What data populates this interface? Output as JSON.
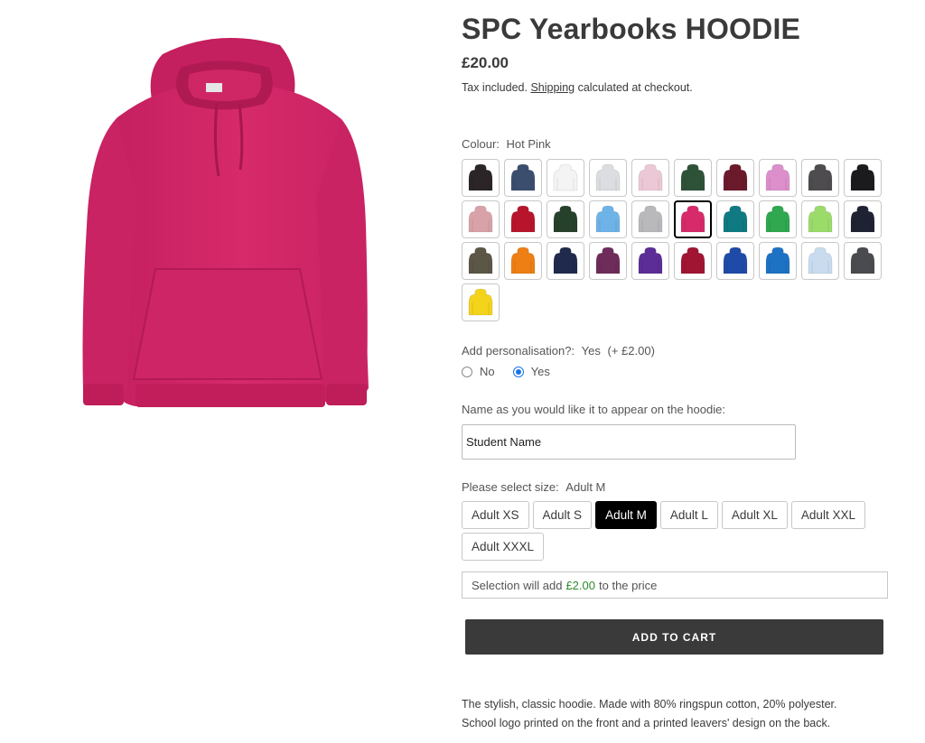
{
  "product": {
    "title": "SPC Yearbooks HOODIE",
    "price": "£20.00",
    "tax_prefix": "Tax included.",
    "tax_link": "Shipping",
    "tax_suffix": "calculated at checkout."
  },
  "colour": {
    "label": "Colour:",
    "selected": "Hot Pink",
    "swatches": [
      {
        "name": "Black Smoke",
        "hex": "#2b2527"
      },
      {
        "name": "Airforce Blue",
        "hex": "#3b4e6e"
      },
      {
        "name": "Arctic White",
        "hex": "#f4f4f4"
      },
      {
        "name": "Ash",
        "hex": "#dcdde0"
      },
      {
        "name": "Baby Pink",
        "hex": "#ecc8d6"
      },
      {
        "name": "Bottle Green",
        "hex": "#2e5238"
      },
      {
        "name": "Burgundy",
        "hex": "#6b1a2c"
      },
      {
        "name": "Candyfloss Pink",
        "hex": "#dc8fcb"
      },
      {
        "name": "Charcoal",
        "hex": "#4e4c4f"
      },
      {
        "name": "Deep Black",
        "hex": "#1b1b1d"
      },
      {
        "name": "Dusty Pink",
        "hex": "#d9a1a8"
      },
      {
        "name": "Fire Red",
        "hex": "#b8142c"
      },
      {
        "name": "Forest Green",
        "hex": "#25402b"
      },
      {
        "name": "Sky Blue",
        "hex": "#6eb3e8"
      },
      {
        "name": "Heather Grey",
        "hex": "#b9b9bc"
      },
      {
        "name": "Hot Pink",
        "hex": "#d62a6a"
      },
      {
        "name": "Jade",
        "hex": "#0f7a82"
      },
      {
        "name": "Kelly Green",
        "hex": "#2fa84f"
      },
      {
        "name": "Lime Green",
        "hex": "#9bdb6a"
      },
      {
        "name": "New French Navy",
        "hex": "#1e2233"
      },
      {
        "name": "Olive Green",
        "hex": "#5b5646"
      },
      {
        "name": "Orange Crush",
        "hex": "#ee7f15"
      },
      {
        "name": "Oxford Navy",
        "hex": "#1f2a4d"
      },
      {
        "name": "Plum",
        "hex": "#6e2c5a"
      },
      {
        "name": "Purple",
        "hex": "#5c2d96"
      },
      {
        "name": "Red Hot Chilli",
        "hex": "#a11432"
      },
      {
        "name": "Royal Blue",
        "hex": "#1f4ba8"
      },
      {
        "name": "Sapphire Blue",
        "hex": "#1e72c4"
      },
      {
        "name": "Sky",
        "hex": "#c9dbee"
      },
      {
        "name": "Storm Grey",
        "hex": "#4a4b4f"
      },
      {
        "name": "Sun Yellow",
        "hex": "#f4d31b"
      }
    ],
    "selected_index": 15
  },
  "personalisation": {
    "label": "Add personalisation?:",
    "selected": "Yes",
    "extra": "(+ £2.00)",
    "options": [
      "No",
      "Yes"
    ]
  },
  "name_field": {
    "label": "Name as you would like it to appear on the hoodie:",
    "value": "Student Name"
  },
  "size": {
    "label": "Please select size:",
    "selected": "Adult M",
    "options": [
      "Adult XS",
      "Adult S",
      "Adult M",
      "Adult L",
      "Adult XL",
      "Adult XXL",
      "Adult XXXL"
    ]
  },
  "price_note": {
    "prefix": "Selection will add",
    "amount": "£2.00",
    "suffix": "to the price"
  },
  "cart": {
    "label": "ADD TO CART"
  },
  "description": {
    "line1": "The stylish, classic hoodie. Made with 80% ringspun cotton, 20% polyester.",
    "line2": "School logo printed on the front and a printed leavers' design on the back."
  },
  "colors": {
    "hoodie_main": "#d62a6a",
    "button_dark": "#3a3a3a",
    "price_green": "#2e8b2e",
    "radio_blue": "#1a73e8"
  }
}
